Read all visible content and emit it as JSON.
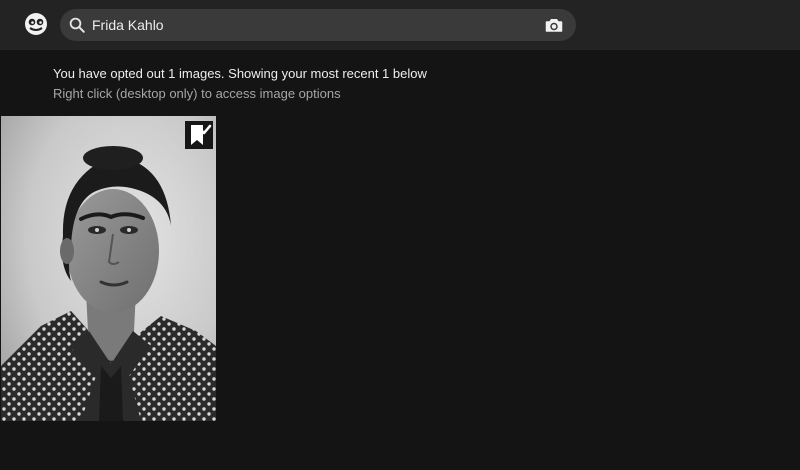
{
  "search": {
    "query": "Frida Kahlo"
  },
  "status": {
    "opted_out_message": "You have opted out 1 images. Showing your most recent 1 below",
    "hint": "Right click (desktop only) to access image options"
  },
  "results": [
    {
      "image_icon": "portrait-photo",
      "badge_icon": "bookmark-check-icon"
    }
  ]
}
